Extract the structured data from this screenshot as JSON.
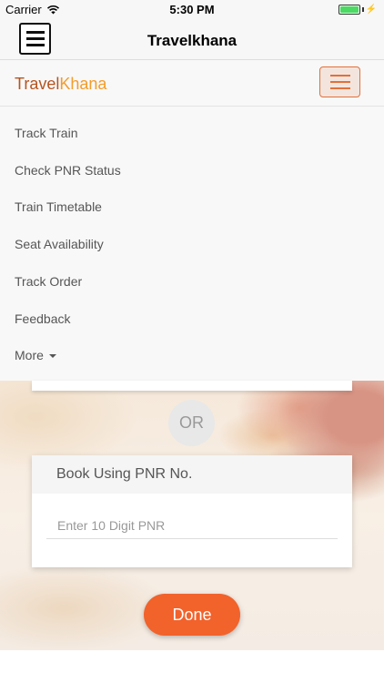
{
  "status_bar": {
    "carrier": "Carrier",
    "time": "5:30 PM",
    "wifi_icon": "wifi-icon",
    "battery_icon": "battery-icon",
    "charging_icon": "bolt-icon",
    "charge_indicator_symbol": "⚡"
  },
  "app_nav": {
    "title": "Travelkhana",
    "menu_icon": "hamburger-icon"
  },
  "site_header": {
    "brand_part1": "Travel",
    "brand_part2": "Khana",
    "brand_color_1": "#b5541f",
    "brand_color_2": "#f39c2a",
    "toggle_icon": "hamburger-icon"
  },
  "menu": {
    "items": [
      {
        "label": "Track Train"
      },
      {
        "label": "Check PNR Status"
      },
      {
        "label": "Train Timetable"
      },
      {
        "label": "Seat Availability"
      },
      {
        "label": "Track Order"
      },
      {
        "label": "Feedback"
      },
      {
        "label": "More"
      }
    ]
  },
  "form": {
    "or_label": "OR",
    "pnr_card_title": "Book Using PNR No.",
    "pnr_placeholder": "Enter 10 Digit PNR",
    "pnr_value": ""
  },
  "actions": {
    "done_label": "Done",
    "accent_color": "#f2622b"
  }
}
